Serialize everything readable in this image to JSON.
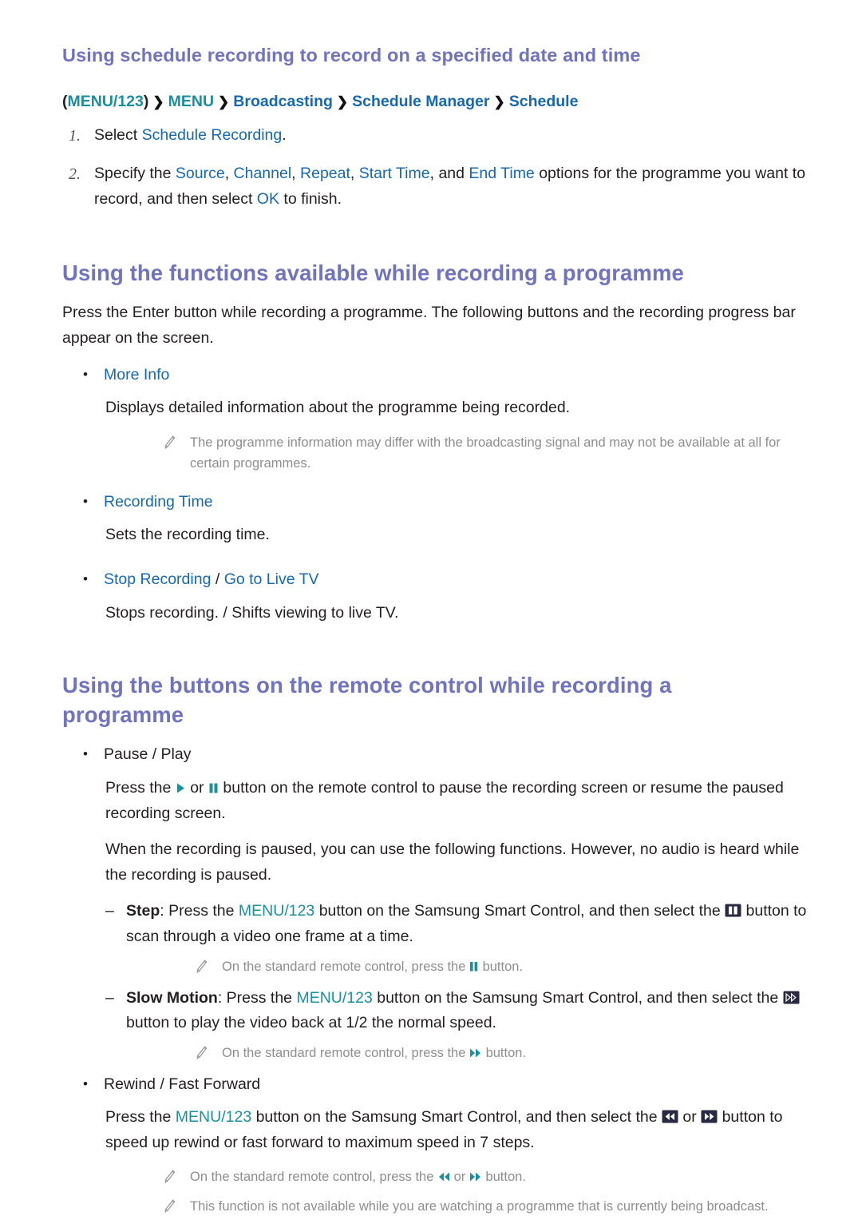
{
  "section1": {
    "heading": "Using schedule recording to record on a specified date and time",
    "breadcrumb": {
      "open_paren": "(",
      "menu123": "MENU/123",
      "close_paren": ")",
      "items": [
        "MENU",
        "Broadcasting",
        "Schedule Manager",
        "Schedule"
      ],
      "separator": "❯"
    },
    "steps": [
      {
        "number": "1.",
        "text_before": "Select ",
        "link": "Schedule Recording",
        "text_after": "."
      },
      {
        "number": "2.",
        "text_before": "Specify the ",
        "links": [
          "Source",
          "Channel",
          "Repeat",
          "Start Time",
          "End Time"
        ],
        "text_mid": " options for the programme you want to record, and then select ",
        "link_ok": "OK",
        "text_after": " to finish."
      }
    ]
  },
  "section2": {
    "heading": "Using the functions available while recording a programme",
    "intro": "Press the Enter button while recording a programme. The following buttons and the recording progress bar appear on the screen.",
    "items": [
      {
        "bullet": "•",
        "label": "More Info",
        "description": "Displays detailed information about the programme being recorded.",
        "note": "The programme information may differ with the broadcasting signal and may not be available at all for certain programmes."
      },
      {
        "bullet": "•",
        "label": "Recording Time",
        "description": "Sets the recording time."
      },
      {
        "bullet": "•",
        "label_a": "Stop Recording",
        "slash": " / ",
        "label_b": "Go to Live TV",
        "description": "Stops recording. / Shifts viewing to live TV."
      }
    ]
  },
  "section3": {
    "heading": "Using the buttons on the remote control while recording a programme",
    "pause_play": {
      "bullet": "•",
      "label": "Pause / Play",
      "line1_a": "Press the ",
      "icon_play": "play-icon",
      "line1_b": " or ",
      "icon_pause": "pause-icon",
      "line1_c": " button on the remote control to pause the recording screen or resume the paused recording screen.",
      "line2": "When the recording is paused, you can use the following functions. However, no audio is heard while the recording is paused."
    },
    "step_item": {
      "dash": "–",
      "label": "Step",
      "colon": ": ",
      "text_a": "Press the ",
      "menu123": "MENU/123",
      "text_b": " button on the Samsung Smart Control, and then select the ",
      "icon": "step-button-icon",
      "text_c": " button to scan through a video one frame at a time.",
      "note_a": "On the standard remote control, press the ",
      "note_icon": "pause-icon",
      "note_b": " button."
    },
    "slow_item": {
      "dash": "–",
      "label": "Slow Motion",
      "colon": ": ",
      "text_a": "Press the ",
      "menu123": "MENU/123",
      "text_b": " button on the Samsung Smart Control, and then select the ",
      "icon": "slow-motion-button-icon",
      "text_c": " button to play the video back at 1/2 the normal speed.",
      "note_a": "On the standard remote control, press the ",
      "note_icon": "fast-forward-icon",
      "note_b": " button."
    },
    "rewind_item": {
      "bullet": "•",
      "label": "Rewind / Fast Forward",
      "text_a": "Press the ",
      "menu123": "MENU/123",
      "text_b": " button on the Samsung Smart Control, and then select the ",
      "icon_rewind": "rewind-button-icon",
      "text_or": " or ",
      "icon_forward": "fast-forward-button-icon",
      "text_c": " button to speed up rewind or fast forward to maximum speed in 7 steps.",
      "note1_a": "On the standard remote control, press the ",
      "note1_icon_rw": "rewind-icon",
      "note1_or": " or ",
      "note1_icon_ff": "fast-forward-icon",
      "note1_b": " button.",
      "note2": "This function is not available while you are watching a programme that is currently being broadcast."
    }
  },
  "colors": {
    "heading": "#6f73c0",
    "link_blue": "#1668b3",
    "teal": "#1a8f9e",
    "body_text": "#231f20",
    "note_gray": "#8e8e8e",
    "icon_navy": "#272a42"
  }
}
